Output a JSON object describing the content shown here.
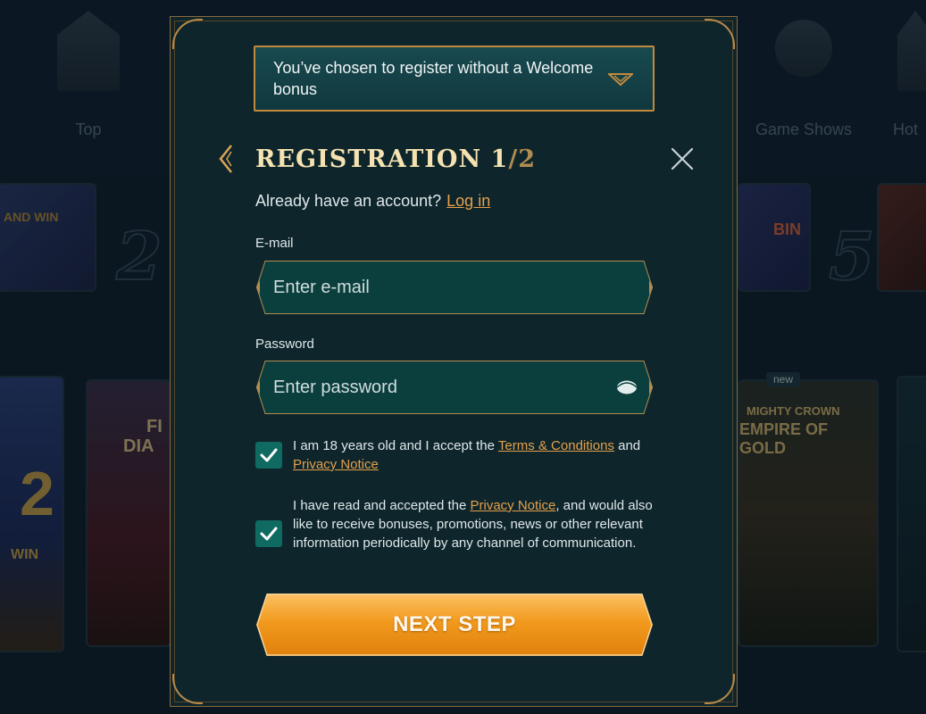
{
  "background": {
    "categories": [
      {
        "label": "Top",
        "icon": "crown-icon"
      },
      {
        "label": "Game Shows",
        "icon": "wheel-icon"
      },
      {
        "label": "Hot",
        "icon": "flame-icon"
      }
    ],
    "top_numbers": [
      "2",
      "5"
    ],
    "tile_texts": [
      "AND WIN",
      "BIN",
      "FI",
      "DIA",
      "2",
      "WIN",
      "MIGHTY CROWN",
      "EMPIRE OF GOLD"
    ],
    "new_badge": "new"
  },
  "modal": {
    "bonus_select": {
      "text": "You’ve chosen to register without a Welcome bonus",
      "icon": "chevron-down-icon"
    },
    "title": "Registration 1",
    "title_step_total": "/2",
    "login_prompt": "Already have an account?",
    "login_link": "Log in",
    "email": {
      "label": "E-mail",
      "placeholder": "Enter e-mail",
      "value": ""
    },
    "password": {
      "label": "Password",
      "placeholder": "Enter password",
      "value": ""
    },
    "terms": {
      "checked": true,
      "text_before": "I am 18 years old and I accept the ",
      "terms_link": "Terms & Conditions",
      "text_mid": " and ",
      "privacy_link": "Privacy Notice"
    },
    "marketing": {
      "checked": true,
      "text_before": "I have read and accepted the ",
      "privacy_link": "Privacy Notice",
      "text_after": ", and would also like to receive bonuses, promotions, news or other relevant information periodically by any channel of communication."
    },
    "next_button": "NEXT STEP"
  },
  "colors": {
    "modal_bg": "#0e252b",
    "accent_gold": "#c08a3e",
    "link": "#e5a14c",
    "checkbox": "#0f6a62",
    "button_orange": "#f29a1d"
  }
}
